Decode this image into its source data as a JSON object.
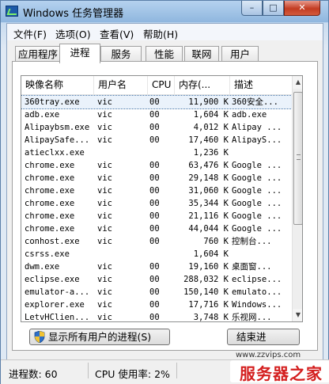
{
  "window": {
    "title": "Windows 任务管理器",
    "min_glyph": "–",
    "max_glyph": "□",
    "close_glyph": "✕"
  },
  "menu": [
    "文件(F)",
    "选项(O)",
    "查看(V)",
    "帮助(H)"
  ],
  "tabs": [
    "应用程序",
    "进程",
    "服务",
    "性能",
    "联网",
    "用户"
  ],
  "active_tab": "进程",
  "columns": [
    "映像名称",
    "用户名",
    "CPU",
    "内存(...",
    "描述"
  ],
  "processes": [
    {
      "name": "360tray.exe",
      "user": "vic",
      "cpu": "00",
      "mem": "11,900 K",
      "desc": "360安全..."
    },
    {
      "name": "adb.exe",
      "user": "vic",
      "cpu": "00",
      "mem": "1,604 K",
      "desc": "adb.exe"
    },
    {
      "name": "Alipaybsm.exe",
      "user": "vic",
      "cpu": "00",
      "mem": "4,012 K",
      "desc": "Alipay ..."
    },
    {
      "name": "AlipaySafe...",
      "user": "vic",
      "cpu": "00",
      "mem": "17,460 K",
      "desc": "AlipayS..."
    },
    {
      "name": "atieclxx.exe",
      "user": "",
      "cpu": "",
      "mem": "1,236 K",
      "desc": ""
    },
    {
      "name": "chrome.exe",
      "user": "vic",
      "cpu": "00",
      "mem": "63,476 K",
      "desc": "Google ..."
    },
    {
      "name": "chrome.exe",
      "user": "vic",
      "cpu": "00",
      "mem": "29,148 K",
      "desc": "Google ..."
    },
    {
      "name": "chrome.exe",
      "user": "vic",
      "cpu": "00",
      "mem": "31,060 K",
      "desc": "Google ..."
    },
    {
      "name": "chrome.exe",
      "user": "vic",
      "cpu": "00",
      "mem": "35,344 K",
      "desc": "Google ..."
    },
    {
      "name": "chrome.exe",
      "user": "vic",
      "cpu": "00",
      "mem": "21,116 K",
      "desc": "Google ..."
    },
    {
      "name": "chrome.exe",
      "user": "vic",
      "cpu": "00",
      "mem": "44,044 K",
      "desc": "Google ..."
    },
    {
      "name": "conhost.exe",
      "user": "vic",
      "cpu": "00",
      "mem": "760 K",
      "desc": "控制台..."
    },
    {
      "name": "csrss.exe",
      "user": "",
      "cpu": "",
      "mem": "1,604 K",
      "desc": ""
    },
    {
      "name": "dwm.exe",
      "user": "vic",
      "cpu": "00",
      "mem": "19,160 K",
      "desc": "桌面窗..."
    },
    {
      "name": "eclipse.exe",
      "user": "vic",
      "cpu": "00",
      "mem": "288,032 K",
      "desc": "eclipse..."
    },
    {
      "name": "emulator-a...",
      "user": "vic",
      "cpu": "00",
      "mem": "150,140 K",
      "desc": "emulato..."
    },
    {
      "name": "explorer.exe",
      "user": "vic",
      "cpu": "00",
      "mem": "17,716 K",
      "desc": "Windows..."
    },
    {
      "name": "LetvHClien...",
      "user": "vic",
      "cpu": "00",
      "mem": "3,748 K",
      "desc": "乐视网..."
    }
  ],
  "selected_row": 0,
  "buttons": {
    "show_all": "显示所有用户的进程(S)",
    "end_process": "结束进"
  },
  "status": {
    "process_count": "进程数: 60",
    "cpu_usage": "CPU 使用率: 2%"
  },
  "watermark": {
    "url": "www.zzvips.com",
    "brand": "服务器之家"
  },
  "colors": {
    "titlebar": "#9fc3e6",
    "close_button": "#c33c22",
    "watermark": "#d41f1f"
  }
}
